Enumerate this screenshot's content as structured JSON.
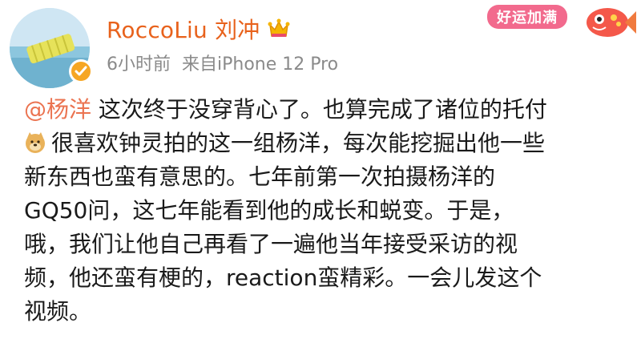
{
  "header": {
    "username": "RoccoLiu 刘冲",
    "time": "6小时前",
    "source": "来自iPhone 12 Pro",
    "badge_text": "好运加满"
  },
  "post": {
    "mention": "@杨洋",
    "line1_rest": " 这次终于没穿背心了。也算完成了诸位的托付",
    "line2": "很喜欢钟灵拍的这一组杨洋，每次能挖掘出他一些",
    "line3": "新东西也蛮有意思的。七年前第一次拍摄杨洋的",
    "line4": "GQ50问，这七年能看到他的成长和蜕变。于是，",
    "line5": "哦，我们让他自己再看了一遍他当年接受采访的视",
    "line6": "频，他还蛮有梗的，reaction蛮精彩。一会儿发这个",
    "line7": "视频。"
  },
  "colors": {
    "username": "#e8621c",
    "mention": "#eb7350",
    "meta": "#8a8a8a",
    "verified": "#f6a623"
  },
  "icons": {
    "verified": "verified-badge-icon",
    "crown": "crown-icon",
    "badge_fish": "lucky-fish-icon",
    "doge": "doge-emoji-icon"
  }
}
